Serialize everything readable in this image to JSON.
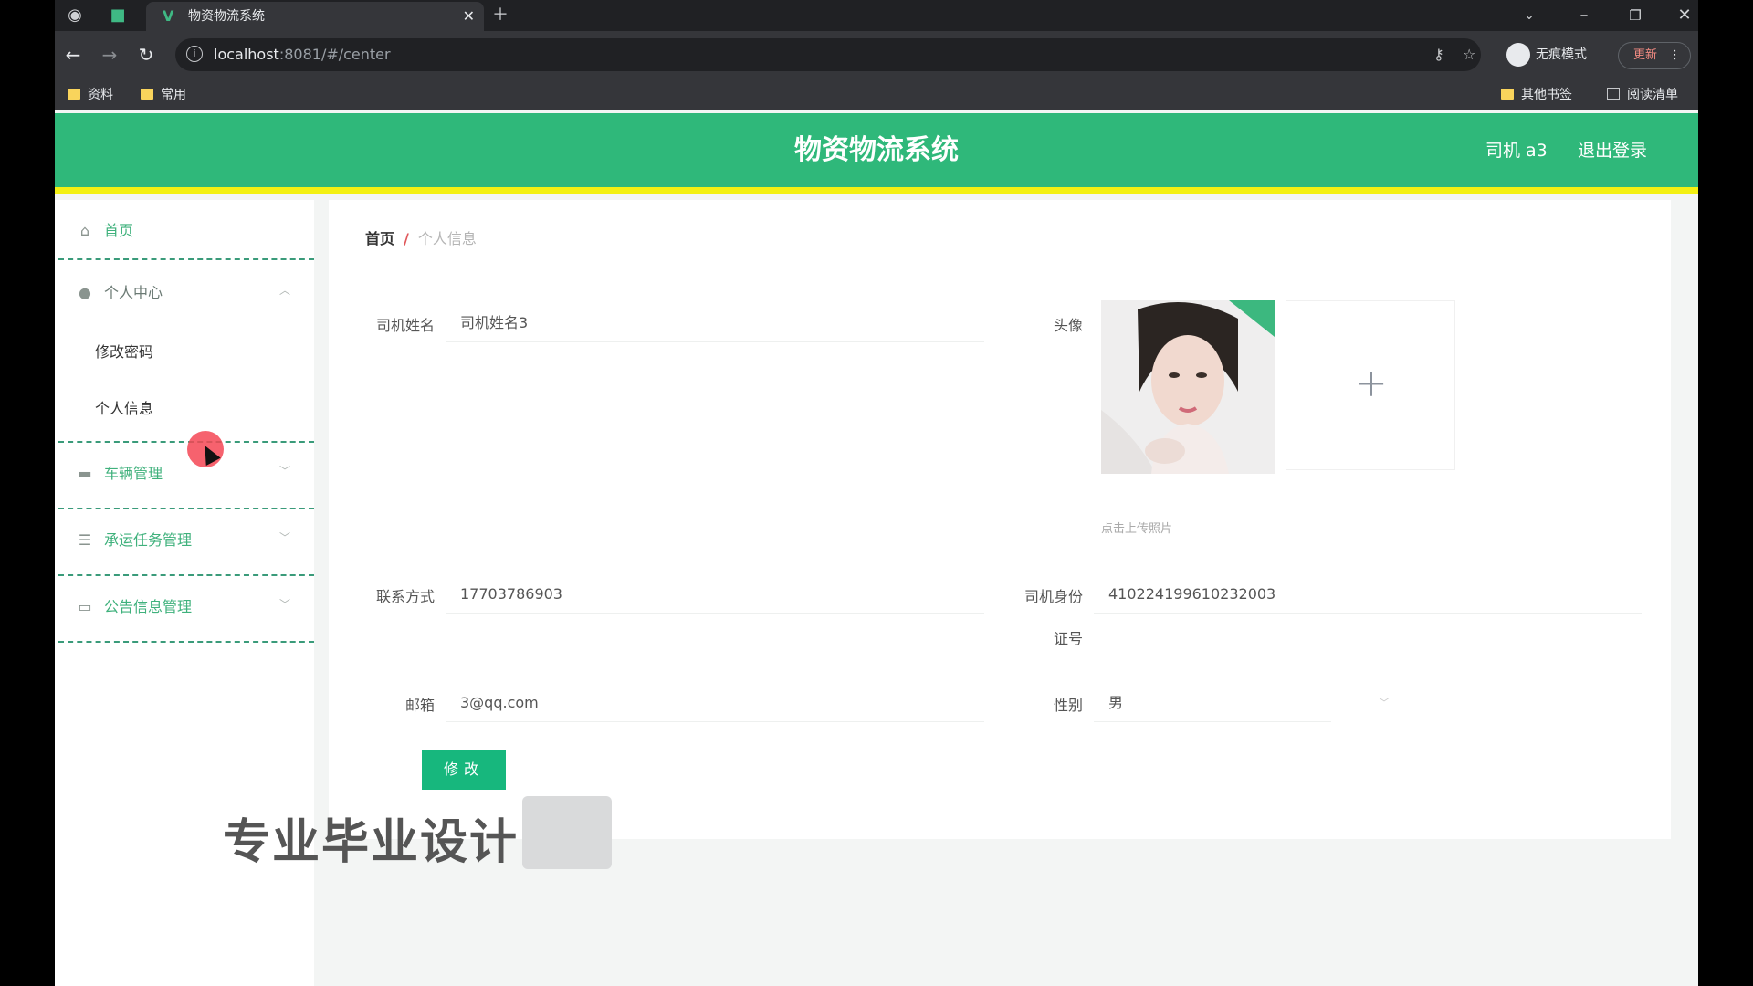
{
  "browser": {
    "tab_title": "物资物流系统",
    "url_host": "localhost",
    "url_path": ":8081/#/center",
    "incognito_label": "无痕模式",
    "update_label": "更新",
    "bookmarks_left": [
      "资料",
      "常用"
    ],
    "bookmark_other": "其他书签",
    "reading_list": "阅读清单"
  },
  "header": {
    "title": "物资物流系统",
    "user": "司机 a3",
    "logout": "退出登录"
  },
  "sidebar": {
    "home": "首页",
    "personal_center": "个人中心",
    "change_password": "修改密码",
    "personal_info": "个人信息",
    "vehicle_mgmt": "车辆管理",
    "task_mgmt": "承运任务管理",
    "notice_mgmt": "公告信息管理"
  },
  "breadcrumb": {
    "home": "首页",
    "separator": "/",
    "current": "个人信息"
  },
  "form": {
    "driver_name_label": "司机姓名",
    "driver_name_value": "司机姓名3",
    "avatar_label": "头像",
    "upload_tip": "点击上传照片",
    "contact_label": "联系方式",
    "contact_value": "17703786903",
    "id_label_line1": "司机身份",
    "id_label_line2": "证号",
    "id_value": "410224199610232003",
    "email_label": "邮箱",
    "email_value": "3@qq.com",
    "gender_label": "性别",
    "gender_value": "男",
    "submit_label": "修改"
  },
  "watermark": "专业毕业设计"
}
